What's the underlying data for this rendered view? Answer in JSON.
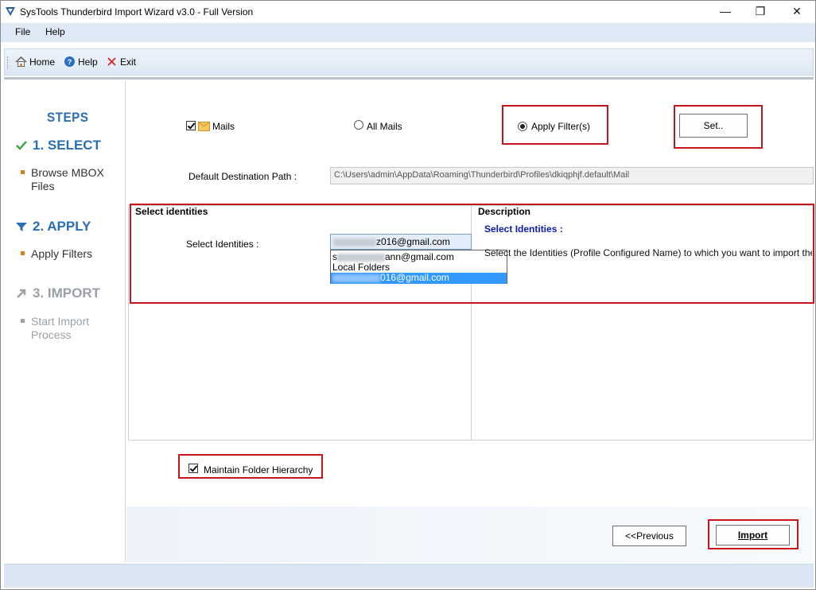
{
  "window": {
    "title": "SysTools Thunderbird Import Wizard v3.0 - Full Version",
    "minimize": "—",
    "maximize": "❐",
    "close": "✕"
  },
  "menu": {
    "file": "File",
    "help": "Help"
  },
  "toolbar": {
    "home": "Home",
    "help": "Help",
    "exit": "Exit"
  },
  "sidebar": {
    "steps_title": "STEPS",
    "steps": [
      {
        "label": "1. SELECT",
        "sub": "Browse MBOX Files",
        "color": "#2a6fb5",
        "icon": "check-icon"
      },
      {
        "label": "2. APPLY",
        "sub": "Apply Filters",
        "color": "#2a6fb5",
        "icon": "filter-icon"
      },
      {
        "label": "3. IMPORT",
        "sub": "Start Import Process",
        "color": "#9aa0a6",
        "icon": "arrow-icon"
      }
    ]
  },
  "options": {
    "mails_label": "Mails",
    "all_mails_label": "All Mails",
    "apply_filter_label": "Apply Filter(s)",
    "set_button": "Set..",
    "dest_label": "Default Destination Path :",
    "dest_path": "C:\\Users\\admin\\AppData\\Roaming\\Thunderbird\\Profiles\\dkiqphjf.default\\Mail"
  },
  "identities": {
    "panel_title": "Select identities",
    "field_label": "Select Identities :",
    "selected_suffix": "z016@gmail.com",
    "dropdown": [
      {
        "prefix": "s",
        "suffix": "ann@gmail.com"
      },
      {
        "prefix": "",
        "suffix": "Local Folders"
      },
      {
        "prefix": "",
        "suffix": "016@gmail.com"
      }
    ]
  },
  "description": {
    "panel_title": "Description",
    "heading": "Select Identities :",
    "text": "Select the Identities (Profile Configured Name) to  which  you want to import the Mbox"
  },
  "maintain_hierarchy": "Maintain Folder Hierarchy",
  "buttons": {
    "previous": "<<Previous",
    "import": "Import"
  },
  "colors": {
    "accent": "#2a6fb5",
    "highlight": "#c4161c",
    "selection": "#3399ff"
  }
}
